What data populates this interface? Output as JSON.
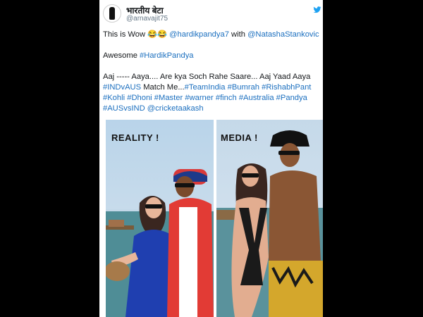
{
  "tweet": {
    "display_name": "भारतीय बेटा",
    "handle": "@arnavajit75",
    "lines": [
      [
        {
          "t": "This is Wow 😂😂 "
        },
        {
          "t": "@hardikpandya7",
          "link": true
        },
        {
          "t": " with "
        },
        {
          "t": "@NatashaStankovic",
          "link": true
        }
      ],
      [],
      [
        {
          "t": "Awesome "
        },
        {
          "t": "#HardikPandya",
          "link": true
        }
      ],
      [],
      [
        {
          "t": "Aaj ----- Aaya.... Are kya Soch Rahe Saare... Aaj Yaad Aaya"
        }
      ],
      [
        {
          "t": "#INDvAUS",
          "link": true
        },
        {
          "t": " Match Me..."
        },
        {
          "t": "#TeamIndia",
          "link": true
        },
        {
          "t": " "
        },
        {
          "t": "#Bumrah",
          "link": true
        },
        {
          "t": " "
        },
        {
          "t": "#RishabhPant",
          "link": true
        }
      ],
      [
        {
          "t": "#Kohli",
          "link": true
        },
        {
          "t": " "
        },
        {
          "t": "#Dhoni",
          "link": true
        },
        {
          "t": " "
        },
        {
          "t": "#Master",
          "link": true
        },
        {
          "t": " "
        },
        {
          "t": "#warner",
          "link": true
        },
        {
          "t": " "
        },
        {
          "t": "#finch",
          "link": true
        },
        {
          "t": " "
        },
        {
          "t": "#Australia",
          "link": true
        },
        {
          "t": " "
        },
        {
          "t": "#Pandya",
          "link": true
        }
      ],
      [
        {
          "t": "#AUSvsIND",
          "link": true
        },
        {
          "t": " "
        },
        {
          "t": "@cricketaakash",
          "link": true
        }
      ]
    ]
  },
  "photo": {
    "left_label": "REALITY !",
    "right_label": "MEDIA !"
  },
  "colors": {
    "link": "#1b6fbf",
    "twitter_blue": "#1da1f2"
  },
  "icons": [
    "twitter-bird-icon"
  ]
}
